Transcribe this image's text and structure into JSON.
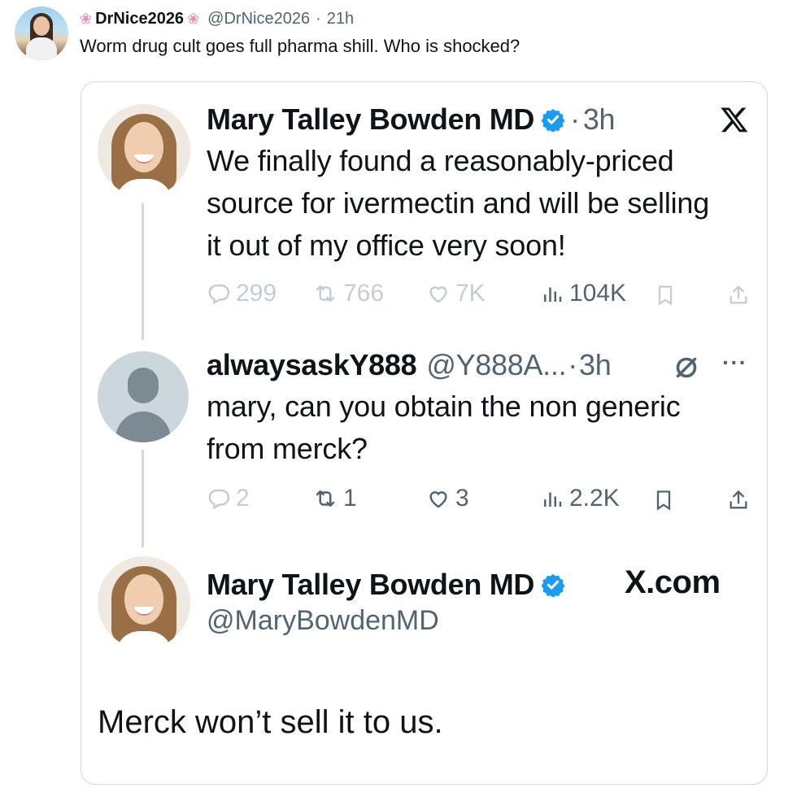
{
  "outer_post": {
    "display_name": "DrNice2026",
    "name_decoration": "❀",
    "handle": "@DrNice2026",
    "separator": "·",
    "time": "21h",
    "text": "Worm drug cult goes full pharma shill. Who is shocked?"
  },
  "quoted_thread": {
    "tweet1": {
      "display_name": "Mary Talley Bowden MD",
      "separator": "·",
      "time": "3h",
      "platform_icon": "x-logo",
      "text_lines": [
        "We finally found a reasonably-priced",
        "source for ivermectin and will be selling",
        "it out of my office very soon!"
      ],
      "replies": "299",
      "reposts": "766",
      "likes": "7K",
      "views": "104K"
    },
    "tweet2": {
      "display_name": "alwaysaskY888",
      "handle": "@Y888A...",
      "separator": "·",
      "time": "3h",
      "more": "···",
      "text_lines": [
        "mary, can you obtain the non generic",
        "from merck?"
      ],
      "replies": "2",
      "reposts": "1",
      "likes": "3",
      "views": "2.2K"
    },
    "tweet3": {
      "display_name": "Mary Talley Bowden MD",
      "handle": "@MaryBowdenMD",
      "platform_label": "X.com",
      "text": "Merck won’t sell it to us."
    }
  },
  "colors": {
    "text": "#0f1419",
    "secondary": "#536471",
    "verified_blue": "#1d9bf0",
    "border": "#cfd9de",
    "flower_pink": "#f08db8"
  },
  "icons": [
    "reply-icon",
    "repost-icon",
    "like-icon",
    "views-icon",
    "bookmark-icon",
    "share-icon",
    "verified-badge-icon",
    "x-logo-icon",
    "slashed-circle-icon",
    "more-icon"
  ]
}
